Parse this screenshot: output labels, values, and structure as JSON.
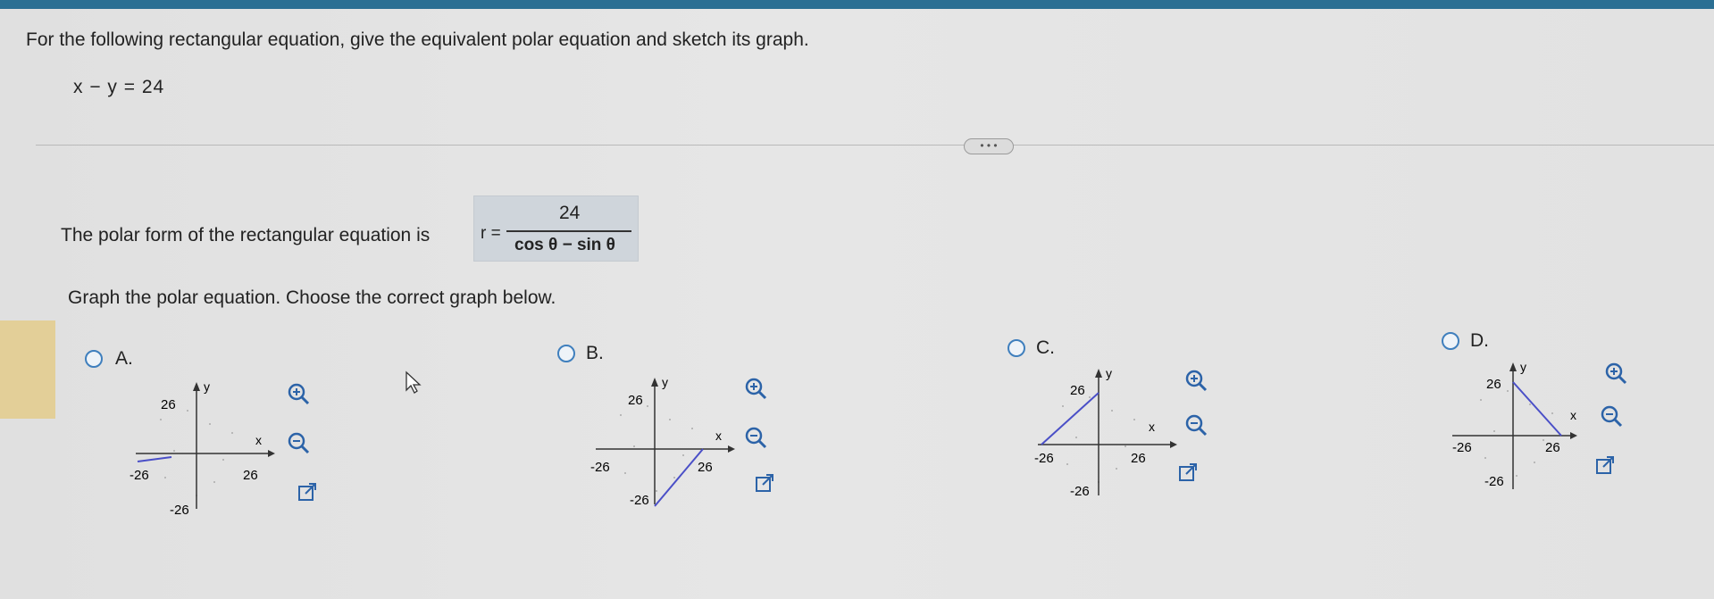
{
  "question": {
    "prompt": "For the following rectangular equation, give the equivalent polar equation and sketch its graph.",
    "equation": "x − y = 24",
    "more_button": "• • •"
  },
  "answer": {
    "prefix_text": "The polar form of the rectangular equation is",
    "r_label": "r =",
    "numerator": "24",
    "denominator": "cos θ − sin θ"
  },
  "graph_prompt": "Graph the polar equation. Choose the correct graph below.",
  "options": [
    {
      "label": "A.",
      "tick": "26",
      "neg_tick": "-26",
      "x_label": "x",
      "y_label": "y"
    },
    {
      "label": "B.",
      "tick": "26",
      "neg_tick": "-26",
      "x_label": "x",
      "y_label": "y"
    },
    {
      "label": "C.",
      "tick": "26",
      "neg_tick": "-26",
      "x_label": "x",
      "y_label": "y"
    },
    {
      "label": "D.",
      "tick": "26",
      "neg_tick": "-26",
      "x_label": "x",
      "y_label": "y"
    }
  ],
  "colors": {
    "line": "#4a4fc7",
    "radio": "#3f7fbd",
    "icon": "#2c63a8",
    "topbar": "#2b6f93"
  },
  "icons": [
    "zoom-in-icon",
    "zoom-out-icon",
    "open-external-icon"
  ]
}
